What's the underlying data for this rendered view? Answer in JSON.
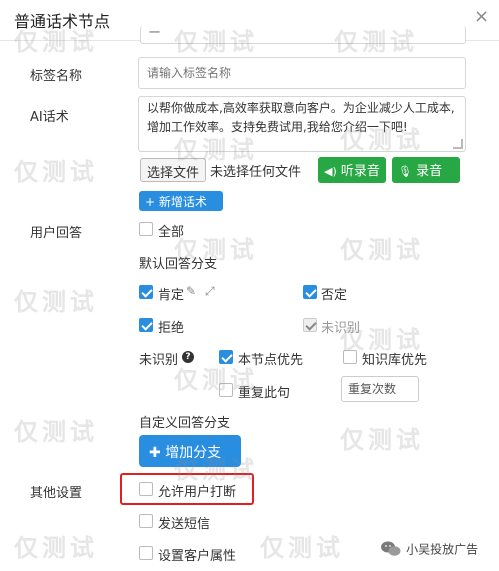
{
  "dialog": {
    "title": "普通话术节点",
    "close_symbol": "×"
  },
  "form": {
    "top_value": "一",
    "tag_name_label": "标签名称",
    "tag_name_placeholder": "请输入标签名称",
    "ai_script_label": "AI话术",
    "ai_script_text": "以帮你做成本,高效率获取意向客户。为企业减少人工成本,增加工作效率。支持免费试用,我给您介绍一下吧!",
    "choose_file_button": "选择文件",
    "no_file_text": "未选择任何文件",
    "listen_button": "听录音",
    "record_button": "录音",
    "new_script_button": "+ 新增话术"
  },
  "user_answer": {
    "label": "用户回答",
    "all_label": "全部",
    "default_branch_title": "默认回答分支",
    "options": [
      {
        "label": "肯定",
        "checked": true,
        "disabled": false
      },
      {
        "label": "否定",
        "checked": true,
        "disabled": false
      },
      {
        "label": "拒绝",
        "checked": true,
        "disabled": false
      },
      {
        "label": "未识别",
        "checked": true,
        "disabled": true
      }
    ],
    "unrecognized_label": "未识别",
    "help_symbol": "?",
    "node_priority_label": "本节点优先",
    "kb_priority_label": "知识库优先",
    "repeat_sentence_label": "重复此句",
    "repeat_count_placeholder": "重复次数",
    "custom_branch_title": "自定义回答分支",
    "add_branch_button": "增加分支"
  },
  "other_settings": {
    "label": "其他设置",
    "allow_interrupt_label": "允许用户打断",
    "send_sms_label": "发送短信",
    "set_customer_attr_label": "设置客户属性"
  },
  "watermark": {
    "text": "仅测试"
  },
  "footer": {
    "brand_text": "小吴投放广告"
  },
  "colors": {
    "accent_blue": "#2a8ee0",
    "accent_green": "#28a745",
    "highlight_red": "#e02020"
  }
}
